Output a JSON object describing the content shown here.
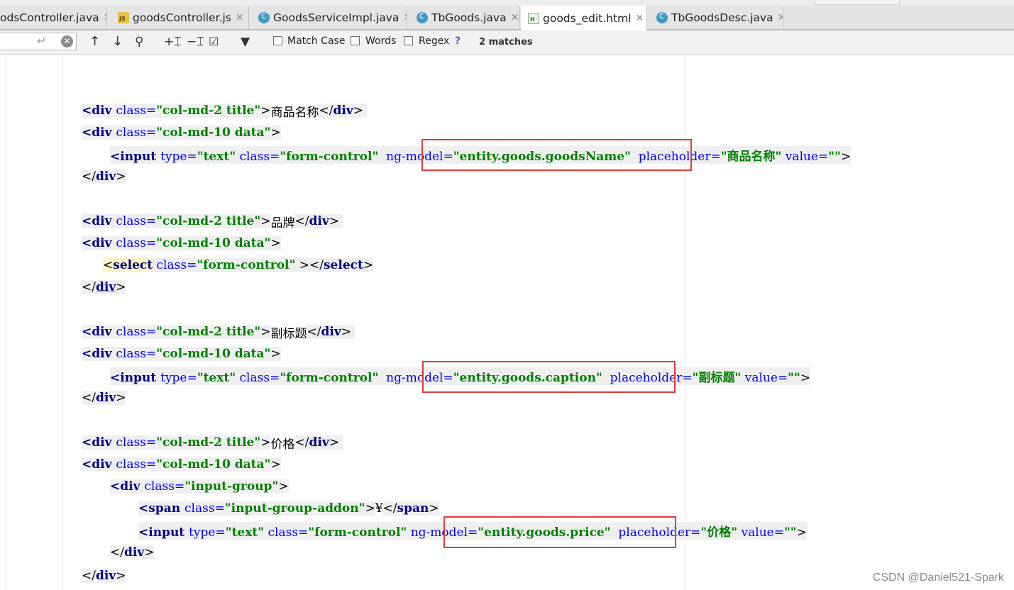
{
  "tabs": [
    {
      "label": "odsController.java",
      "icon": "close-icon",
      "type": "java"
    },
    {
      "label": "goodsController.js",
      "icon": "js-file-icon",
      "type": "js"
    },
    {
      "label": "GoodsServiceImpl.java",
      "icon": "java-class-icon",
      "type": "java"
    },
    {
      "label": "TbGoods.java",
      "icon": "java-class-icon",
      "type": "java"
    },
    {
      "label": "goods_edit.html",
      "icon": "html-file-icon",
      "type": "html",
      "active": true
    },
    {
      "label": "TbGoodsDesc.java",
      "icon": "java-class-icon",
      "type": "java"
    }
  ],
  "findbar": {
    "search_value": "",
    "match_case_label": "Match Case",
    "words_label": "Words",
    "regex_label": "Regex",
    "help": "?",
    "matches": "2 matches"
  },
  "code": {
    "l1": {
      "open": "<div ",
      "attr1": "class=",
      "val1": "\"col-md-2 title\"",
      "gt": ">",
      "text": "商品名称",
      "close_open": "</",
      "close_tag": "div",
      "close_end": ">"
    },
    "l2": {
      "open": "<div ",
      "attr1": "class=",
      "val1": "\"col-md-10 data\"",
      "gt": ">"
    },
    "l3": {
      "open": "<input ",
      "attr1": "type=",
      "val1": "\"text\"",
      "attr2": " class=",
      "val2": "\"form-control\"",
      "attr3": "  ng-model=",
      "val3": "\"entity.goods.goodsName\"",
      "attr4": "  placeholder=",
      "val4": "\"商品名称\"",
      "attr5": " value=",
      "val5": "\"\"",
      "gt": ">"
    },
    "l4": {
      "close_open": "</",
      "close_tag": "div",
      "close_end": ">"
    },
    "l5": {
      "open": "<div ",
      "attr1": "class=",
      "val1": "\"col-md-2 title\"",
      "gt": ">",
      "text": "品牌",
      "close_open": "</",
      "close_tag": "div",
      "close_end": ">"
    },
    "l6": {
      "open": "<div ",
      "attr1": "class=",
      "val1": "\"col-md-10 data\"",
      "gt": ">"
    },
    "l7": {
      "lt": "<",
      "tag": "select",
      "attr1": " class=",
      "val1": "\"form-control\"",
      "mid": " ></",
      "close_tag": "select",
      "close_end": ">"
    },
    "l8": {
      "close_open": "</",
      "close_tag": "div",
      "close_end": ">"
    },
    "l9": {
      "open": "<div ",
      "attr1": "class=",
      "val1": "\"col-md-2 title\"",
      "gt": ">",
      "text": "副标题",
      "close_open": "</",
      "close_tag": "div",
      "close_end": ">"
    },
    "l10": {
      "open": "<div ",
      "attr1": "class=",
      "val1": "\"col-md-10 data\"",
      "gt": ">"
    },
    "l11": {
      "open": "<input ",
      "attr1": "type=",
      "val1": "\"text\"",
      "attr2": " class=",
      "val2": "\"form-control\"",
      "attr3": "  ng-model=",
      "val3": "\"entity.goods.caption\"",
      "attr4": "  placeholder=",
      "val4": "\"副标题\"",
      "attr5": " value=",
      "val5": "\"\"",
      "gt": ">"
    },
    "l12": {
      "close_open": "</",
      "close_tag": "div",
      "close_end": ">"
    },
    "l13": {
      "open": "<div ",
      "attr1": "class=",
      "val1": "\"col-md-2 title\"",
      "gt": ">",
      "text": "价格",
      "close_open": "</",
      "close_tag": "div",
      "close_end": ">"
    },
    "l14": {
      "open": "<div ",
      "attr1": "class=",
      "val1": "\"col-md-10 data\"",
      "gt": ">"
    },
    "l15": {
      "open": "<div ",
      "attr1": "class=",
      "val1": "\"input-group\"",
      "gt": ">"
    },
    "l16": {
      "open": "<span ",
      "attr1": "class=",
      "val1": "\"input-group-addon\"",
      "gt": ">",
      "text": "¥",
      "close_open": "</",
      "close_tag": "span",
      "close_end": ">"
    },
    "l17": {
      "open": "<input ",
      "attr1": "type=",
      "val1": "\"text\"",
      "attr2": " class=",
      "val2": "\"form-control\"",
      "attr3": " ng-model=",
      "val3": "\"entity.goods.price\"",
      "attr4": "  placeholder=",
      "val4": "\"价格\"",
      "attr5": " value=",
      "val5": "\"\"",
      "gt": ">"
    },
    "l18": {
      "close_open": "</",
      "close_tag": "div",
      "close_end": ">"
    },
    "l19": {
      "close_open": "</",
      "close_tag": "div",
      "close_end": ">"
    }
  },
  "watermark": "CSDN @Daniel521-Spark",
  "colors": {
    "tag": "#000080",
    "attr": "#0000ff",
    "value": "#008000",
    "highlight_box": "#e23b3b"
  }
}
